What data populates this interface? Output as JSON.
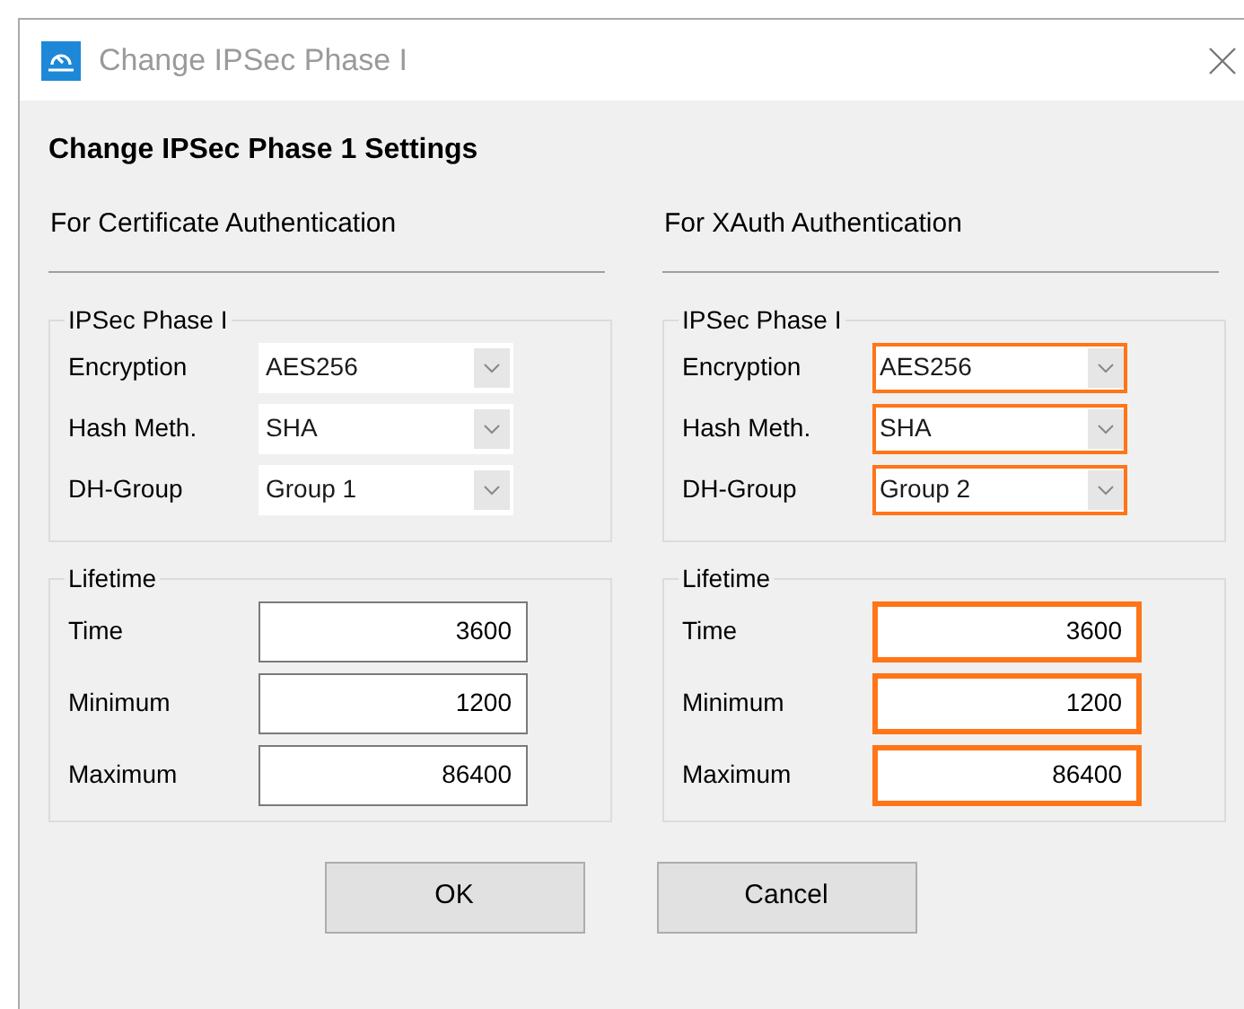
{
  "window": {
    "title": "Change IPSec Phase I"
  },
  "heading": "Change IPSec Phase 1 Settings",
  "columns": [
    {
      "title": "For Certificate Authentication",
      "phase_group": {
        "title": "IPSec Phase I",
        "fields": [
          {
            "label": "Encryption",
            "value": "AES256",
            "highlighted": false
          },
          {
            "label": "Hash Meth.",
            "value": "SHA",
            "highlighted": false
          },
          {
            "label": "DH-Group",
            "value": "Group 1",
            "highlighted": false
          }
        ]
      },
      "lifetime_group": {
        "title": "Lifetime",
        "fields": [
          {
            "label": "Time",
            "value": "3600",
            "highlighted": false
          },
          {
            "label": "Minimum",
            "value": "1200",
            "highlighted": false
          },
          {
            "label": "Maximum",
            "value": "86400",
            "highlighted": false
          }
        ]
      }
    },
    {
      "title": "For XAuth Authentication",
      "phase_group": {
        "title": "IPSec Phase I",
        "fields": [
          {
            "label": "Encryption",
            "value": "AES256",
            "highlighted": true
          },
          {
            "label": "Hash Meth.",
            "value": "SHA",
            "highlighted": true
          },
          {
            "label": "DH-Group",
            "value": "Group 2",
            "highlighted": true
          }
        ]
      },
      "lifetime_group": {
        "title": "Lifetime",
        "fields": [
          {
            "label": "Time",
            "value": "3600",
            "highlighted": true
          },
          {
            "label": "Minimum",
            "value": "1200",
            "highlighted": true
          },
          {
            "label": "Maximum",
            "value": "86400",
            "highlighted": true
          }
        ]
      }
    }
  ],
  "buttons": [
    "OK",
    "Cancel"
  ]
}
